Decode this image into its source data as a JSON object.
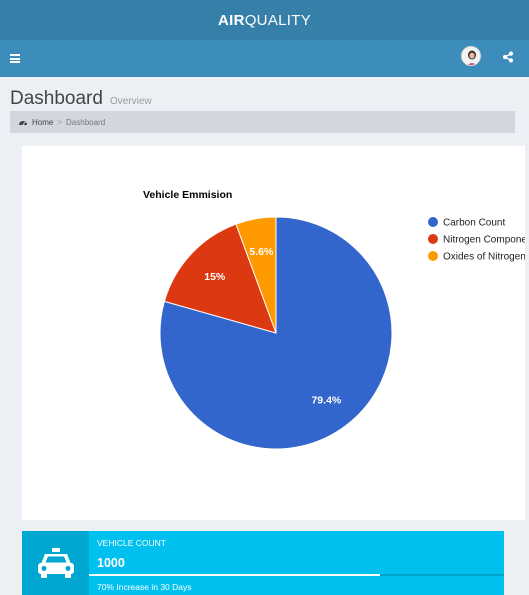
{
  "header": {
    "logo_bold": "AIR",
    "logo_rest": "QUALITY"
  },
  "navbar": {
    "menu_icon": "hamburger-icon",
    "avatar": "user-avatar",
    "share_icon": "share-icon"
  },
  "content_header": {
    "title": "Dashboard",
    "subtitle": "Overview"
  },
  "breadcrumb": {
    "home": "Home",
    "separator": ">",
    "current": "Dashboard"
  },
  "chart_data": {
    "type": "pie",
    "title": "Vehicle Emmision",
    "legend_position": "right",
    "slices": [
      {
        "label": "Carbon Count",
        "value": 79.4,
        "display": "79.4%",
        "color": "#3366cc"
      },
      {
        "label": "Nitrogen Component",
        "value": 15,
        "display": "15%",
        "color": "#dc3912"
      },
      {
        "label": "Oxides of Nitrogen",
        "value": 5.6,
        "display": "5.6%",
        "color": "#ff9900"
      }
    ]
  },
  "info_box": {
    "icon": "taxi-icon",
    "label": "VEHICLE COUNT",
    "number": "1000",
    "progress_percent": 70,
    "description": "70% Increase in 30 Days"
  }
}
